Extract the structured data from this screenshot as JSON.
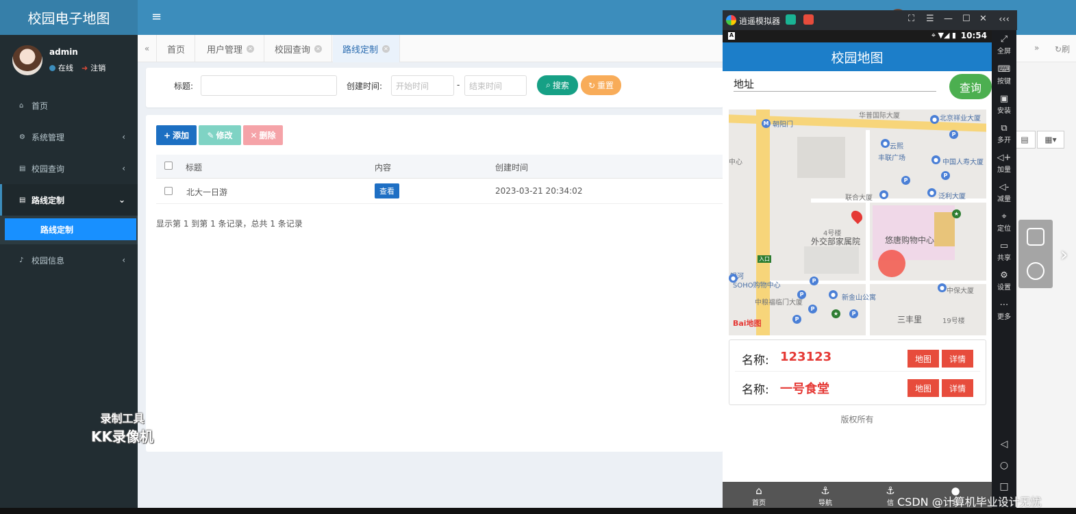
{
  "app": {
    "title": "校园电子地图",
    "user": "admin"
  },
  "sidebar": {
    "user_name": "admin",
    "online": "在线",
    "logout": "注销",
    "items": [
      {
        "label": "首页"
      },
      {
        "label": "系统管理"
      },
      {
        "label": "校园查询"
      },
      {
        "label": "路线定制"
      },
      {
        "label": "校园信息"
      }
    ],
    "sub_active": "路线定制"
  },
  "tabs": [
    {
      "label": "首页"
    },
    {
      "label": "用户管理"
    },
    {
      "label": "校园查询"
    },
    {
      "label": "路线定制"
    }
  ],
  "right_tab": "刷",
  "search": {
    "title_label": "标题:",
    "time_label": "创建时间:",
    "start_placeholder": "开始时间",
    "end_placeholder": "结束时间",
    "dash": "-",
    "search_btn": "搜索",
    "reset_btn": "重置"
  },
  "toolbar": {
    "add": "添加",
    "edit": "修改",
    "delete": "删除"
  },
  "table": {
    "headers": [
      "标题",
      "内容",
      "创建时间"
    ],
    "rows": [
      {
        "title": "北大一日游",
        "content": "查看",
        "created": "2023-03-21 20:34:02"
      }
    ],
    "summary": "显示第 1 到第 1 条记录，总共 1 条记录"
  },
  "watermark": {
    "line1": "录制工具",
    "line2": "KK录像机"
  },
  "emulator": {
    "title": "逍遥模拟器",
    "time": "10:54",
    "side": [
      "全屏",
      "按键",
      "安装",
      "多开",
      "加量",
      "减量",
      "定位",
      "共享",
      "设置",
      "更多"
    ]
  },
  "phone": {
    "app_title": "校园地图",
    "address": "地址",
    "query_btn": "查询",
    "map_labels": {
      "chaoyangmen": "朝阳门",
      "huamao": "华普国际大厦",
      "beijingxiangye": "北京祥业大厦",
      "yunxi": "云熙",
      "fenglian": "丰联广场",
      "zhongxin": "中心",
      "zhongguo": "中国人寿大厦",
      "lianhe": "联合大厦",
      "fanli": "泛利大厦",
      "waijiaobu": "外交部家属院",
      "youtang": "悠唐购物中心",
      "building4": "4号楼",
      "yinhe": "银河",
      "soho": "SOHO购物中心",
      "zhongbao": "中保大厦",
      "zhongliang": "中粮福临门大厦",
      "xinjinshan": "新金山公寓",
      "sanfengli": "三丰里",
      "building19": "19号楼",
      "rukou": "入口",
      "baidu": "Bai地图"
    },
    "cards": [
      {
        "label": "名称:",
        "name": "123123",
        "map_btn": "地图",
        "detail_btn": "详情"
      },
      {
        "label": "名称:",
        "name": "一号食堂",
        "map_btn": "地图",
        "detail_btn": "详情"
      }
    ],
    "copyright": "版权所有",
    "nav": [
      "首页",
      "导航",
      "信",
      "我"
    ]
  },
  "csdn": "CSDN @计算机毕业设计无忧"
}
